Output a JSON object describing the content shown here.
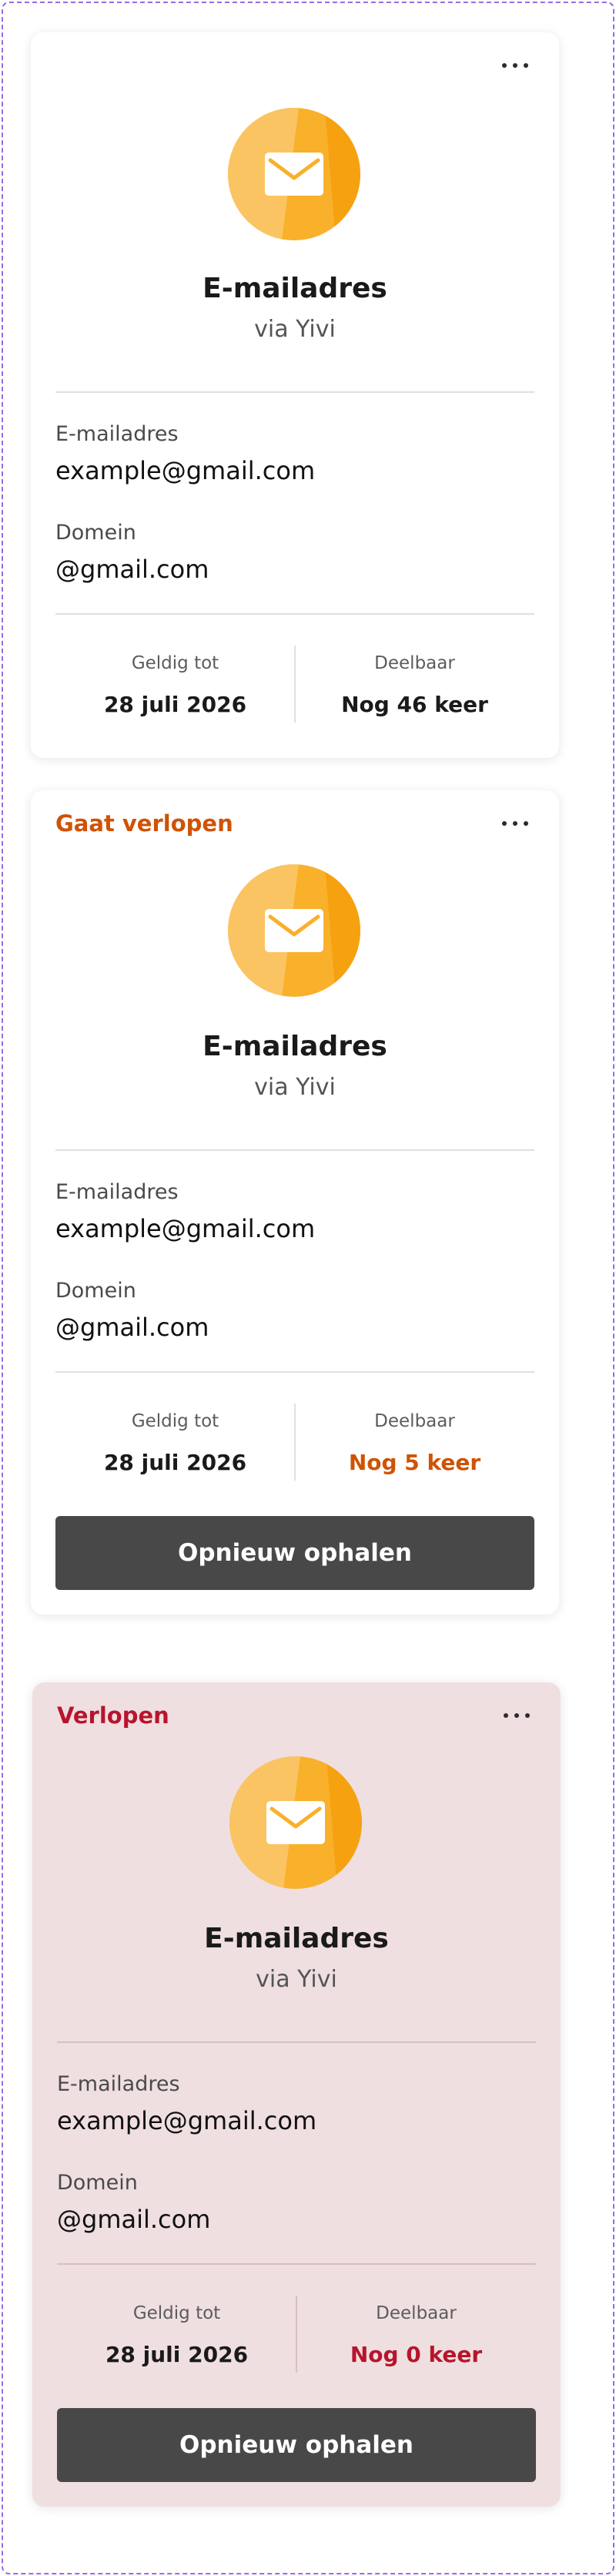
{
  "cards": [
    {
      "status": "",
      "title": "E-mailadres",
      "subtitle": "via Yivi",
      "fields": [
        {
          "label": "E-mailadres",
          "value": "example@gmail.com"
        },
        {
          "label": "Domein",
          "value": "@gmail.com"
        }
      ],
      "valid_until_label": "Geldig tot",
      "valid_until": "28 juli 2026",
      "shareable_label": "Deelbaar",
      "shareable": "Nog 46 keer",
      "button": ""
    },
    {
      "status": "Gaat verlopen",
      "title": "E-mailadres",
      "subtitle": "via Yivi",
      "fields": [
        {
          "label": "E-mailadres",
          "value": "example@gmail.com"
        },
        {
          "label": "Domein",
          "value": "@gmail.com"
        }
      ],
      "valid_until_label": "Geldig tot",
      "valid_until": "28 juli 2026",
      "shareable_label": "Deelbaar",
      "shareable": "Nog 5 keer",
      "button": "Opnieuw ophalen"
    },
    {
      "status": "Verlopen",
      "title": "E-mailadres",
      "subtitle": "via Yivi",
      "fields": [
        {
          "label": "E-mailadres",
          "value": "example@gmail.com"
        },
        {
          "label": "Domein",
          "value": "@gmail.com"
        }
      ],
      "valid_until_label": "Geldig tot",
      "valid_until": "28 juli 2026",
      "shareable_label": "Deelbaar",
      "shareable": "Nog 0 keer",
      "button": "Opnieuw ophalen"
    }
  ],
  "icons": {
    "card_icon": "envelope-icon",
    "menu_icon": "more-horizontal-icon"
  },
  "colors": {
    "warning": "#cf5304",
    "error": "#b7152d",
    "expired_background": "#efdfe0",
    "button": "#484848",
    "icon_orange": "#f9b02a"
  }
}
